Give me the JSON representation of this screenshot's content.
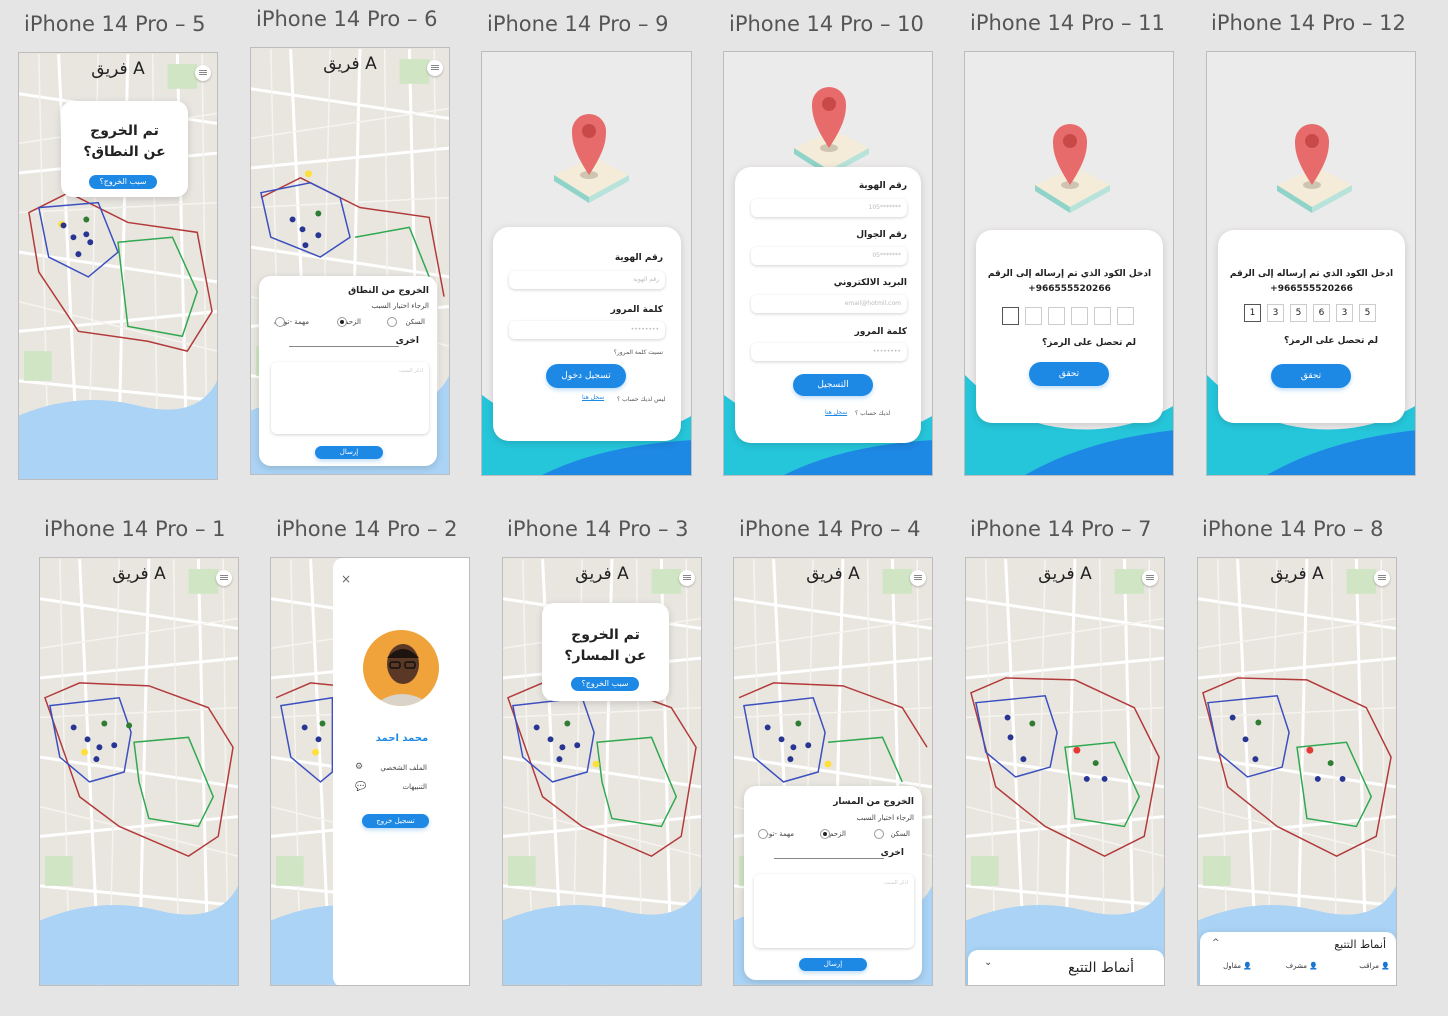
{
  "colors": {
    "primary": "#1e88e5",
    "wave": "#26c6da",
    "zoneRed": "#b23a3a",
    "zoneBlue": "#3b4fbf",
    "zoneGreen": "#2fa84f"
  },
  "frames": {
    "f5": "iPhone 14 Pro – 5",
    "f6": "iPhone 14 Pro – 6",
    "f9": "iPhone 14 Pro – 9",
    "f10": "iPhone 14 Pro – 10",
    "f11": "iPhone 14 Pro – 11",
    "f12": "iPhone 14 Pro – 12",
    "f1": "iPhone 14 Pro – 1",
    "f2": "iPhone 14 Pro – 2",
    "f3": "iPhone 14 Pro – 3",
    "f4": "iPhone 14 Pro – 4",
    "f7": "iPhone 14 Pro – 7",
    "f8": "iPhone 14 Pro – 8"
  },
  "team": "فريق A",
  "menu_icon": "hamburger-icon",
  "alert_zone": {
    "line1": "تم الخروج",
    "line2": "عن النطاق؟",
    "button": "سبب الخروج؟"
  },
  "alert_route": {
    "line1": "تم الخروج",
    "line2": "عن المسار؟",
    "button": "سبب الخروج؟"
  },
  "reason_zone": {
    "title": "الخروج من النطاق",
    "subtitle": "الرجاء اختيار السبب",
    "opt1": "السكن",
    "opt2": "الزحم",
    "opt3": "مهمة -توجيه",
    "other": "اخرى",
    "placeholder": "اذكر السبب",
    "send": "إرسال"
  },
  "reason_route": {
    "title": "الخروج من المسار",
    "subtitle": "الرجاء اختيار السبب",
    "opt1": "السكن",
    "opt2": "الزحم",
    "opt3": "مهمة -توجيه",
    "other": "اخرى",
    "placeholder": "اذكر السبب",
    "send": "إرسال"
  },
  "login": {
    "id_label": "رقم الهوية",
    "id_placeholder": "رقم الهوية",
    "pw_label": "كلمة المرور",
    "pw_value": "••••••••",
    "forgot": "نسيت كلمة المرور؟",
    "button": "تسجيل دخول",
    "no_account": "ليس لديك حساب ؟",
    "register_link": "سجل هنا"
  },
  "register": {
    "id_label": "رقم الهوية",
    "id_value": "105*******",
    "phone_label": "رقم الجوال",
    "phone_value": "05*******",
    "email_label": "البريد الالكتروني",
    "email_value": "email@hotmil.com",
    "pw_label": "كلمة المرور",
    "pw_value": "••••••••",
    "button": "التسجيل",
    "have_account": "لديك حساب ؟",
    "login_link": "سجل هنا"
  },
  "otp_empty": {
    "line1": "ادخل الكود الذي تم إرساله إلى الرقم",
    "phone": "+966555520266",
    "resend": "لم تحصل على الرمز؟",
    "verify": "تحقق"
  },
  "otp_filled": {
    "line1": "ادخل الكود الذي تم إرساله إلى الرقم",
    "phone": "+966555520266",
    "resend": "لم تحصل على الرمز؟",
    "verify": "تحقق",
    "digits": [
      "1",
      "3",
      "5",
      "6",
      "3",
      "5"
    ]
  },
  "drawer": {
    "close_icon": "close-icon",
    "name": "محمد احمد",
    "profile": "الملف الشخصي",
    "notifications": "التنبيهات",
    "logout": "تسجيل خروج"
  },
  "tracking": {
    "title": "أنماط التتبع",
    "opt_observer": "مراقب",
    "opt_supervisor": "مشرف",
    "opt_contractor": "مقاول"
  }
}
